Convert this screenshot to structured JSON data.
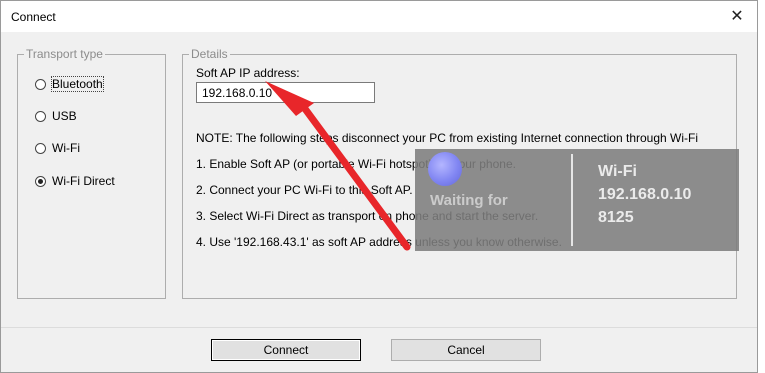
{
  "window": {
    "title": "Connect",
    "close_glyph": "✕"
  },
  "transport": {
    "legend": "Transport type",
    "options": [
      {
        "label": "Bluetooth",
        "checked": false,
        "focused": true
      },
      {
        "label": "USB",
        "checked": false
      },
      {
        "label": "Wi-Fi",
        "checked": false
      },
      {
        "label": "Wi-Fi Direct",
        "checked": true
      }
    ]
  },
  "details": {
    "legend": "Details",
    "ip_label": "Soft AP IP address:",
    "ip_value": "192.168.0.10",
    "note_lines": [
      "NOTE: The following steps disconnect your PC from existing Internet connection through Wi-Fi",
      "1. Enable Soft AP (or portable Wi-Fi hotspot) on your phone.",
      "2. Connect your PC Wi-Fi to this Soft AP.",
      "3. Select Wi-Fi Direct as transport on phone and start the server.",
      "4. Use '192.168.43.1' as soft AP address unless you know otherwise."
    ]
  },
  "overlay": {
    "waiting_text": "Waiting for",
    "connection_type": "Wi-Fi",
    "ip": "192.168.0.10",
    "port": "8125",
    "bubble_color": "#8186f2"
  },
  "annotation": {
    "arrow_color": "#e8262a"
  },
  "buttons": {
    "connect": "Connect",
    "cancel": "Cancel"
  }
}
